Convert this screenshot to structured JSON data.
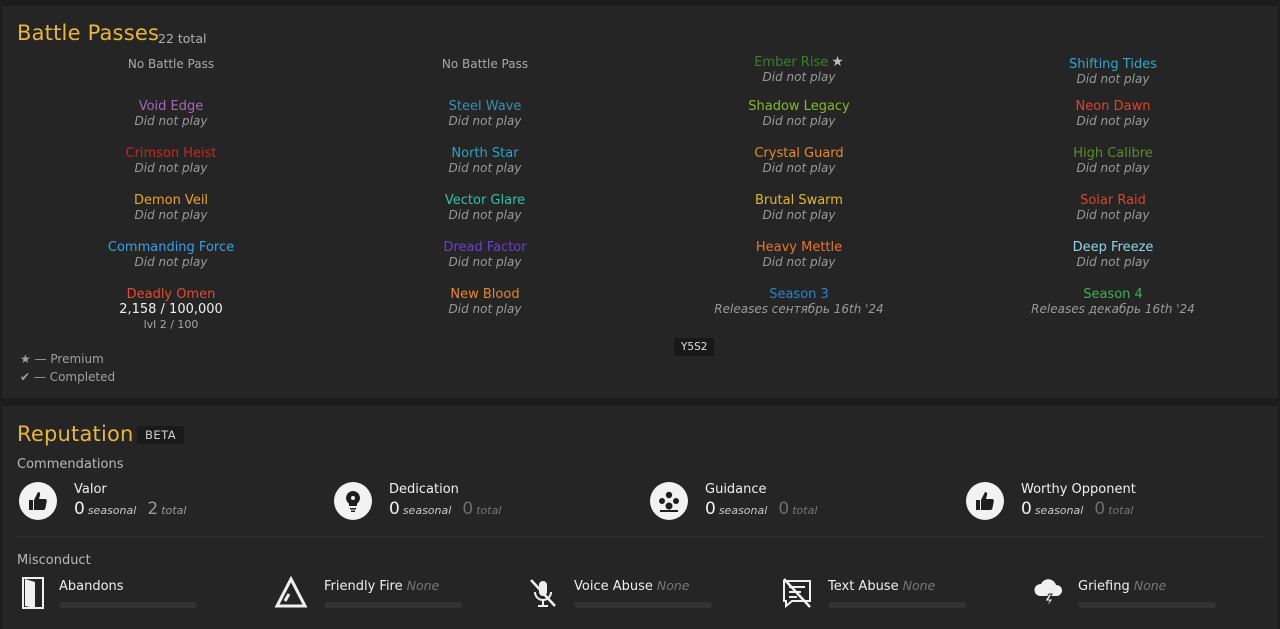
{
  "battle_passes": {
    "title": "Battle Passes",
    "total": "22 total",
    "tag": "Y5S2",
    "legend_premium": "★ — Premium",
    "legend_completed": "✔ — Completed",
    "passes": [
      {
        "name": "No Battle Pass",
        "plain": true
      },
      {
        "name": "No Battle Pass",
        "plain": true
      },
      {
        "name": "Ember Rise",
        "sub": "Did not play",
        "color": "#3d7f2e",
        "premium": true
      },
      {
        "name": "Shifting Tides",
        "sub": "Did not play",
        "color": "#2fa8c9"
      },
      {
        "name": "Void Edge",
        "sub": "Did not play",
        "color": "#a866b8"
      },
      {
        "name": "Steel Wave",
        "sub": "Did not play",
        "color": "#3b8fb4"
      },
      {
        "name": "Shadow Legacy",
        "sub": "Did not play",
        "color": "#86b82e"
      },
      {
        "name": "Neon Dawn",
        "sub": "Did not play",
        "color": "#e0432b"
      },
      {
        "name": "Crimson Heist",
        "sub": "Did not play",
        "color": "#c8261e"
      },
      {
        "name": "North Star",
        "sub": "Did not play",
        "color": "#2ba3c8"
      },
      {
        "name": "Crystal Guard",
        "sub": "Did not play",
        "color": "#e88a2a"
      },
      {
        "name": "High Calibre",
        "sub": "Did not play",
        "color": "#5e8a2b"
      },
      {
        "name": "Demon Veil",
        "sub": "Did not play",
        "color": "#e8a42c"
      },
      {
        "name": "Vector Glare",
        "sub": "Did not play",
        "color": "#33c2a2"
      },
      {
        "name": "Brutal Swarm",
        "sub": "Did not play",
        "color": "#e0b830"
      },
      {
        "name": "Solar Raid",
        "sub": "Did not play",
        "color": "#d8452a"
      },
      {
        "name": "Commanding Force",
        "sub": "Did not play",
        "color": "#3aa0e6"
      },
      {
        "name": "Dread Factor",
        "sub": "Did not play",
        "color": "#6d3fd1"
      },
      {
        "name": "Heavy Mettle",
        "sub": "Did not play",
        "color": "#e8782a"
      },
      {
        "name": "Deep Freeze",
        "sub": "Did not play",
        "color": "#93d6ec"
      },
      {
        "name": "Deadly Omen",
        "progress": "2,158 / 100,000",
        "level": "lvl 2 / 100",
        "color": "#e24a33"
      },
      {
        "name": "New Blood",
        "sub": "Did not play",
        "color": "#e8842a"
      },
      {
        "name": "Season 3",
        "sub": "Releases сентябрь 16th '24",
        "color": "#2a86c9"
      },
      {
        "name": "Season 4",
        "sub": "Releases декабрь 16th '24",
        "color": "#3fae52"
      }
    ]
  },
  "reputation": {
    "title": "Reputation",
    "badge": "BETA",
    "commendations_label": "Commendations",
    "seasonal_label": "seasonal",
    "total_label": "total",
    "commendations": [
      {
        "name": "Valor",
        "seasonal": "0",
        "total": "2",
        "icon": "thumbs-up-icon",
        "highlight_total": true
      },
      {
        "name": "Dedication",
        "seasonal": "0",
        "total": "0",
        "icon": "lightbulb-icon"
      },
      {
        "name": "Guidance",
        "seasonal": "0",
        "total": "0",
        "icon": "group-icon"
      },
      {
        "name": "Worthy Opponent",
        "seasonal": "0",
        "total": "0",
        "icon": "thumbs-up-icon"
      }
    ],
    "misconduct_label": "Misconduct",
    "misconduct": [
      {
        "name": "Abandons",
        "value": "",
        "icon": "door-icon"
      },
      {
        "name": "Friendly Fire",
        "value": "None",
        "icon": "triangle-icon"
      },
      {
        "name": "Voice Abuse",
        "value": "None",
        "icon": "muted-mic-icon"
      },
      {
        "name": "Text Abuse",
        "value": "None",
        "icon": "crossed-message-icon"
      },
      {
        "name": "Griefing",
        "value": "None",
        "icon": "storm-cloud-icon"
      }
    ]
  }
}
